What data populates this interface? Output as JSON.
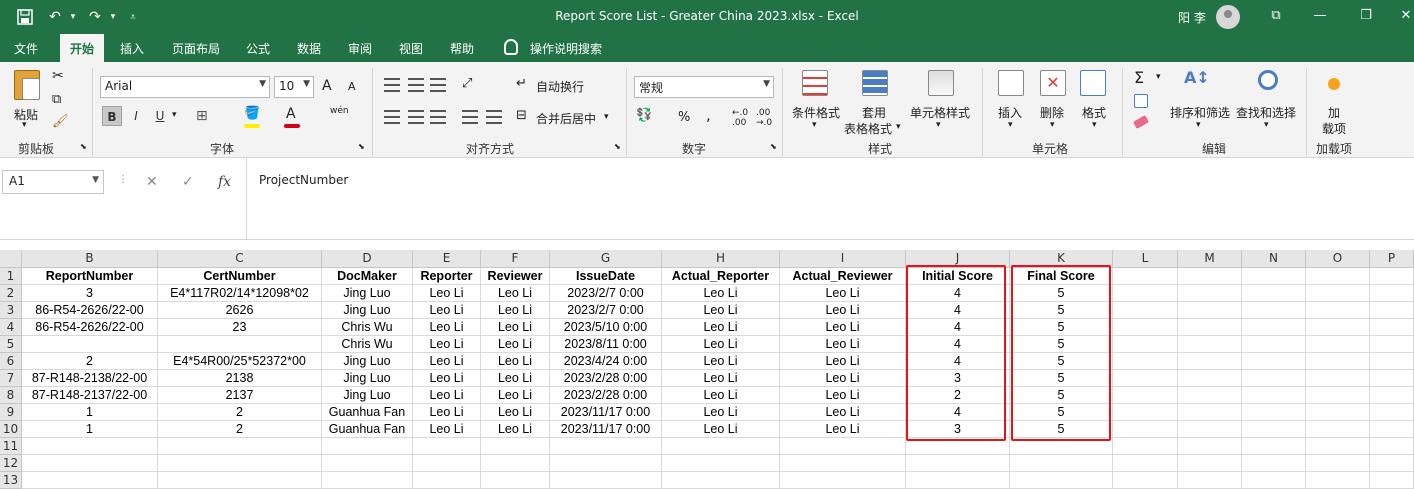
{
  "window": {
    "title": "Report Score List - Greater China 2023.xlsx  -  Excel",
    "user_name": "阳 李"
  },
  "tabs": [
    "文件",
    "开始",
    "插入",
    "页面布局",
    "公式",
    "数据",
    "审阅",
    "视图",
    "帮助",
    "操作说明搜索"
  ],
  "active_tab": "开始",
  "ribbon": {
    "clipboard": {
      "paste": "粘贴",
      "label": "剪贴板"
    },
    "font": {
      "name": "Arial",
      "size": "10",
      "bold": "B",
      "italic": "I",
      "underline": "U",
      "label": "字体",
      "grow": "A",
      "shrink": "A",
      "phonetic": "wén"
    },
    "alignment": {
      "wrap": "自动换行",
      "merge": "合并后居中",
      "label": "对齐方式"
    },
    "number": {
      "format": "常规",
      "percent": "%",
      "comma": ",",
      "label": "数字"
    },
    "styles": {
      "conditional": "条件格式",
      "table_line1": "套用",
      "table_line2": "表格格式",
      "cell_styles": "单元格样式",
      "label": "样式"
    },
    "cells": {
      "insert": "插入",
      "delete": "删除",
      "format": "格式",
      "label": "单元格"
    },
    "editing": {
      "sort_filter": "排序和筛选",
      "find_select": "查找和选择",
      "label": "编辑"
    },
    "addins": {
      "line1": "加",
      "line2": "载项",
      "label": "加载项"
    }
  },
  "formula_bar": {
    "name_box": "A1",
    "formula": "ProjectNumber"
  },
  "grid": {
    "columns": [
      "B",
      "C",
      "D",
      "E",
      "F",
      "G",
      "H",
      "I",
      "J",
      "K",
      "L",
      "M",
      "N",
      "O",
      "P"
    ],
    "row_numbers": [
      "1",
      "2",
      "3",
      "4",
      "5",
      "6",
      "7",
      "8",
      "9",
      "10",
      "11",
      "12",
      "13"
    ],
    "headers": [
      "ReportNumber",
      "CertNumber",
      "DocMaker",
      "Reporter",
      "Reviewer",
      "IssueDate",
      "Actual_Reporter",
      "Actual_Reviewer",
      "Initial Score",
      "Final Score"
    ],
    "rows": [
      [
        "3",
        "E4*117R02/14*12098*02",
        "Jing Luo",
        "Leo Li",
        "Leo Li",
        "2023/2/7 0:00",
        "Leo Li",
        "Leo Li",
        "4",
        "5"
      ],
      [
        "86-R54-2626/22-00",
        "2626",
        "Jing Luo",
        "Leo Li",
        "Leo Li",
        "2023/2/7 0:00",
        "Leo Li",
        "Leo Li",
        "4",
        "5"
      ],
      [
        "86-R54-2626/22-00",
        "23",
        "Chris Wu",
        "Leo Li",
        "Leo Li",
        "2023/5/10 0:00",
        "Leo Li",
        "Leo Li",
        "4",
        "5"
      ],
      [
        "",
        "",
        "Chris Wu",
        "Leo Li",
        "Leo Li",
        "2023/8/11 0:00",
        "Leo Li",
        "Leo Li",
        "4",
        "5"
      ],
      [
        "2",
        "E4*54R00/25*52372*00",
        "Jing Luo",
        "Leo Li",
        "Leo Li",
        "2023/4/24 0:00",
        "Leo Li",
        "Leo Li",
        "4",
        "5"
      ],
      [
        "87-R148-2138/22-00",
        "2138",
        "Jing Luo",
        "Leo Li",
        "Leo Li",
        "2023/2/28 0:00",
        "Leo Li",
        "Leo Li",
        "3",
        "5"
      ],
      [
        "87-R148-2137/22-00",
        "2137",
        "Jing Luo",
        "Leo Li",
        "Leo Li",
        "2023/2/28 0:00",
        "Leo Li",
        "Leo Li",
        "2",
        "5"
      ],
      [
        "1",
        "2",
        "Guanhua Fan",
        "Leo Li",
        "Leo Li",
        "2023/11/17 0:00",
        "Leo Li",
        "Leo Li",
        "4",
        "5"
      ],
      [
        "1",
        "2",
        "Guanhua Fan",
        "Leo Li",
        "Leo Li",
        "2023/11/17 0:00",
        "Leo Li",
        "Leo Li",
        "3",
        "5"
      ]
    ]
  },
  "colors": {
    "excel_green": "#217346",
    "highlight_red": "#e8121a"
  },
  "icons": [
    "save-icon",
    "undo-icon",
    "redo-icon",
    "customize-icon",
    "avatar",
    "lightbulb-icon",
    "paste-icon",
    "cut-icon",
    "copy-icon",
    "format-painter-icon",
    "fill-color-icon",
    "font-color-icon",
    "sum-icon",
    "sort-filter-icon",
    "find-icon",
    "cancel-icon",
    "enter-icon",
    "fx-icon"
  ]
}
